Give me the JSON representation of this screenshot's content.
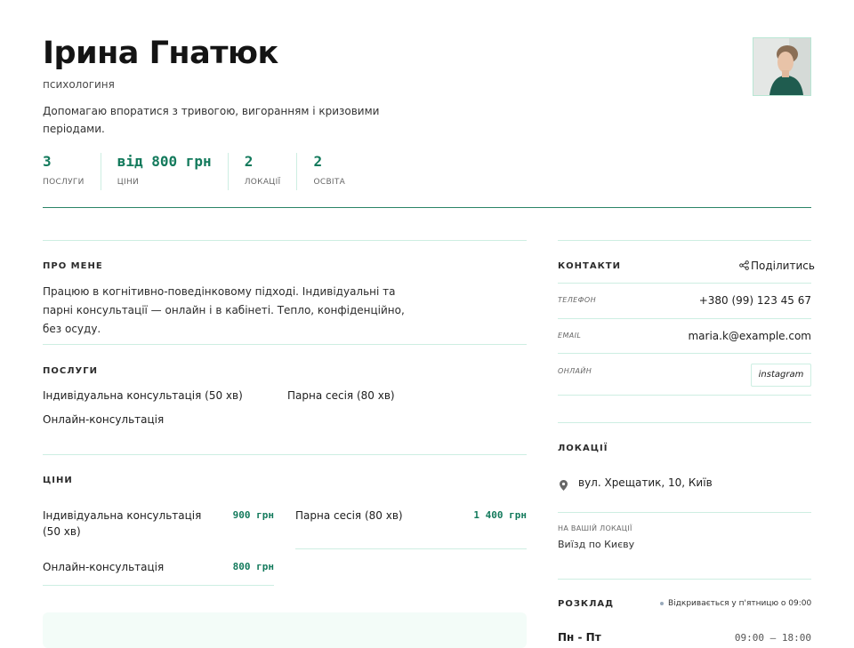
{
  "profile": {
    "name": "Ірина Гнатюк",
    "role": "психологиня",
    "tagline": "Допомагаю впоратися з тривогою, вигоранням і кризовими періодами."
  },
  "stats": [
    {
      "value": "3",
      "label": "ПОСЛУГИ"
    },
    {
      "value": "від 800 грн",
      "label": "ЦІНИ"
    },
    {
      "value": "2",
      "label": "ЛОКАЦІЇ"
    },
    {
      "value": "2",
      "label": "ОСВІТА"
    }
  ],
  "about": {
    "title": "ПРО МЕНЕ",
    "text": "Працюю в когнітивно-поведінковому підході. Індивідуальні та парні консультації — онлайн і в кабінеті. Тепло, конфіденційно, без осуду."
  },
  "services": {
    "title": "ПОСЛУГИ",
    "items": [
      "Індивідуальна консультація (50 хв)",
      "Парна сесія (80 хв)",
      "Онлайн-консультація"
    ]
  },
  "prices": {
    "title": "ЦІНИ",
    "items": [
      {
        "name": "Індивідуальна консультація (50 хв)",
        "price": "900 грн"
      },
      {
        "name": "Парна сесія (80 хв)",
        "price": "1 400 грн"
      },
      {
        "name": "Онлайн-консультація",
        "price": "800 грн"
      }
    ]
  },
  "contacts": {
    "title": "КОНТАКТИ",
    "share_label": "Поділитись",
    "rows": [
      {
        "label": "ТЕЛЕФОН",
        "value": "+380 (99) 123 45 67"
      },
      {
        "label": "EMAIL",
        "value": "maria.k@example.com"
      },
      {
        "label": "ОНЛАЙН",
        "value": "instagram"
      }
    ]
  },
  "locations": {
    "title": "ЛОКАЦІЇ",
    "address": "вул. Хрещатик, 10, Київ",
    "at_your_location_label": "НА ВАШІЙ ЛОКАЦІЇ",
    "at_your_location_value": "Виїзд по Києву"
  },
  "schedule": {
    "title": "РОЗКЛАД",
    "status": "Відкривається у п'ятницю о 09:00",
    "rows": [
      {
        "days": "Пн - Пт",
        "hours": "09:00 — 18:00"
      }
    ]
  },
  "colors": {
    "accent": "#137a5c",
    "rule": "#cdeee2",
    "header_rule": "#2a8467"
  }
}
